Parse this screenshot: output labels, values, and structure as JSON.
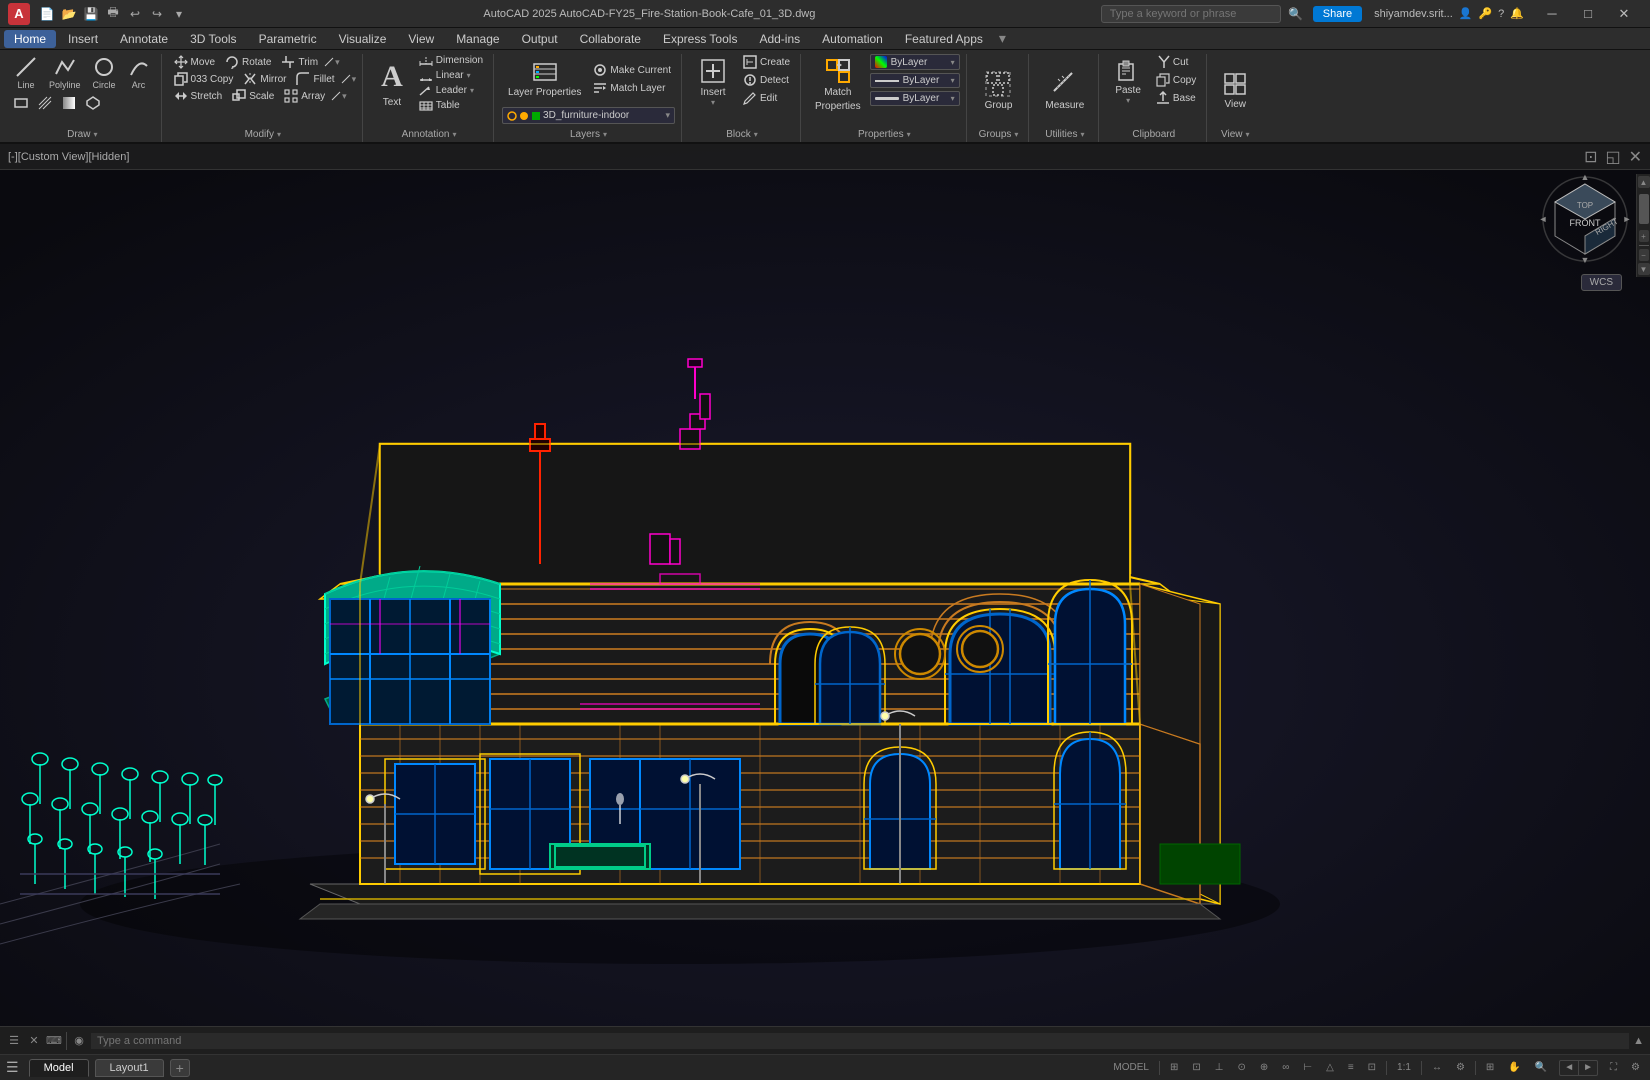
{
  "titlebar": {
    "logo": "A",
    "title": "AutoCAD 2025   AutoCAD-FY25_Fire-Station-Book-Cafe_01_3D.dwg",
    "share_label": "Share",
    "search_placeholder": "Type a keyword or phrase",
    "user": "shiyamdev.srit...",
    "minimize": "─",
    "maximize": "□",
    "close": "✕"
  },
  "menubar": {
    "items": [
      "Home",
      "Insert",
      "Annotate",
      "3D Tools",
      "Parametric",
      "Visualize",
      "View",
      "Manage",
      "Output",
      "Collaborate",
      "Express Tools",
      "Add-ins",
      "Automation",
      "Featured Apps"
    ]
  },
  "ribbon": {
    "draw_group": {
      "label": "Draw",
      "items": [
        {
          "id": "line",
          "icon": "╱",
          "label": "Line"
        },
        {
          "id": "polyline",
          "icon": "⌒",
          "label": "Polyline"
        },
        {
          "id": "circle",
          "icon": "○",
          "label": "Circle"
        },
        {
          "id": "arc",
          "icon": "⌒",
          "label": "Arc"
        }
      ]
    },
    "modify_group": {
      "label": "Modify",
      "items": [
        {
          "id": "move",
          "icon": "✥",
          "label": "Move"
        },
        {
          "id": "rotate",
          "icon": "↻",
          "label": "Rotate"
        },
        {
          "id": "trim",
          "icon": "✂",
          "label": "Trim"
        },
        {
          "id": "copy",
          "icon": "⎘",
          "label": "033 Copy"
        },
        {
          "id": "mirror",
          "icon": "⇔",
          "label": "Mirror"
        },
        {
          "id": "fillet",
          "icon": "⌐",
          "label": "Fillet"
        },
        {
          "id": "stretch",
          "icon": "↔",
          "label": "Stretch"
        },
        {
          "id": "scale",
          "icon": "⤡",
          "label": "Scale"
        },
        {
          "id": "array",
          "icon": "⊞",
          "label": "Array"
        }
      ]
    },
    "annotation_group": {
      "label": "Annotation",
      "items": [
        {
          "id": "text",
          "icon": "A",
          "label": "Text"
        },
        {
          "id": "dimension",
          "icon": "⇿",
          "label": "Dimension"
        },
        {
          "id": "linear",
          "icon": "↔",
          "label": "Linear"
        },
        {
          "id": "leader",
          "icon": "↗",
          "label": "Leader"
        },
        {
          "id": "table",
          "icon": "⊞",
          "label": "Table"
        }
      ]
    },
    "layers_group": {
      "label": "Layers",
      "layer_name": "3D_furniture-indoor",
      "items": [
        {
          "id": "layer-props",
          "label": "Layer Properties"
        },
        {
          "id": "make-current",
          "label": "Make Current"
        },
        {
          "id": "match-layer",
          "label": "Match Layer"
        }
      ]
    },
    "block_group": {
      "label": "Block",
      "items": [
        {
          "id": "insert",
          "label": "Insert"
        },
        {
          "id": "create",
          "label": "Create"
        },
        {
          "id": "edit",
          "label": "Edit"
        },
        {
          "id": "detect",
          "label": "Detect"
        }
      ]
    },
    "properties_group": {
      "label": "Properties",
      "bylayer1": "ByLayer",
      "bylayer2": "ByLayer",
      "items": [
        {
          "id": "match-props",
          "label": "Match Properties"
        }
      ]
    },
    "groups_group": {
      "label": "Groups",
      "items": [
        {
          "id": "group",
          "label": "Group"
        }
      ]
    },
    "utilities_group": {
      "label": "Utilities",
      "items": [
        {
          "id": "measure",
          "label": "Measure"
        }
      ]
    },
    "clipboard_group": {
      "label": "Clipboard",
      "items": [
        {
          "id": "paste",
          "label": "Paste"
        },
        {
          "id": "base",
          "label": "Base"
        }
      ]
    },
    "view_group": {
      "label": "View"
    }
  },
  "viewport": {
    "label": "[-][Custom View][Hidden]",
    "home_icon": "⌂",
    "wcs_label": "WCS"
  },
  "command_bar": {
    "placeholder": "Type a command",
    "model_label": "MODEL"
  },
  "statusbar": {
    "tabs": [
      "Model",
      "Layout1"
    ],
    "add_tab": "+",
    "tools": [
      "⊞",
      "::",
      "·",
      "⊙",
      "1:1",
      "↔",
      "↕",
      "∠",
      "∥",
      "⊡",
      "⊕",
      "☰"
    ]
  }
}
